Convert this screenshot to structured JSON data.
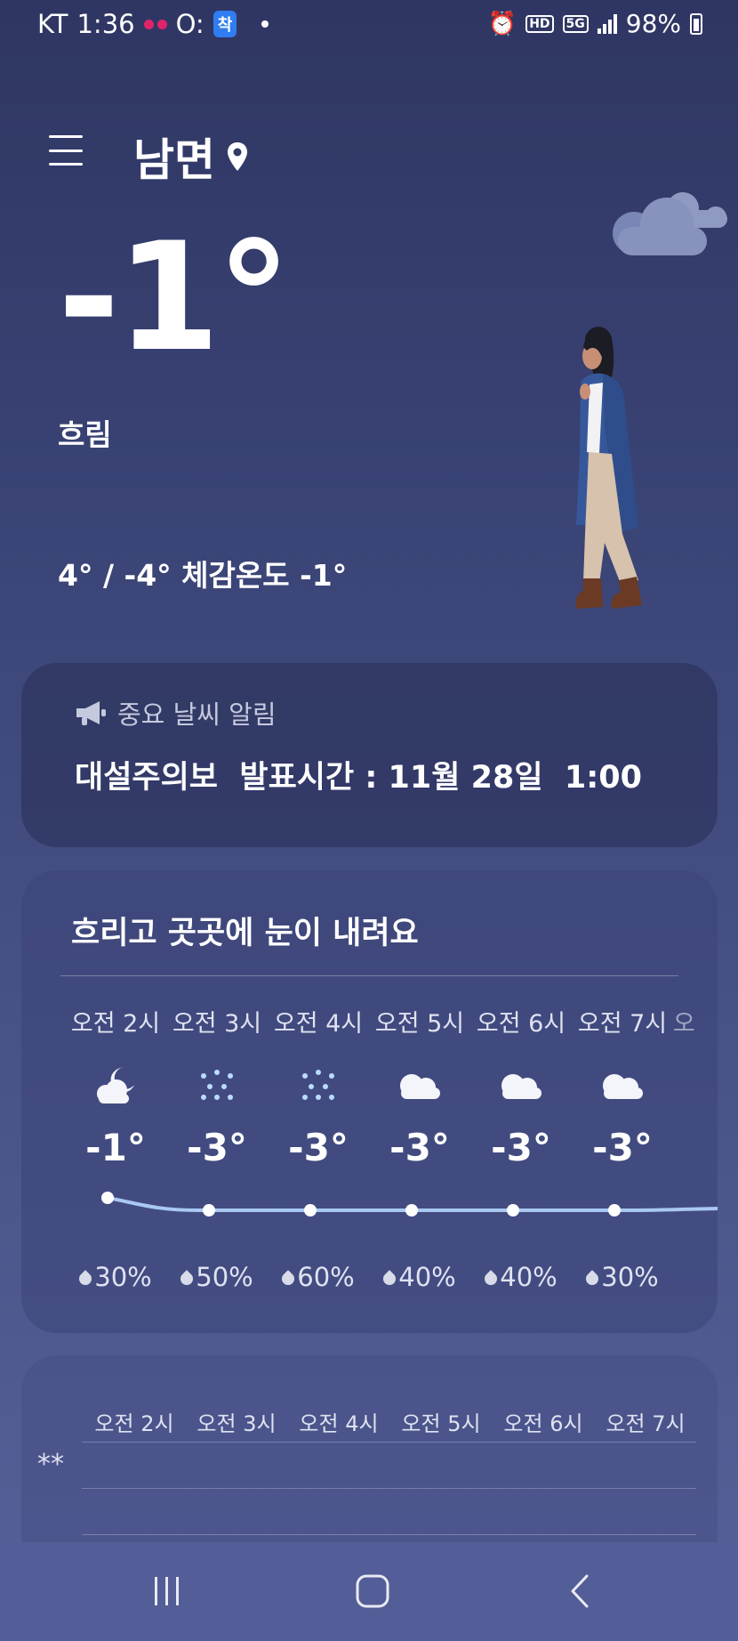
{
  "status_bar": {
    "carrier": "KT",
    "time": "1:36",
    "badge_o": "O:",
    "badge_talk": "착",
    "hd_label": "HD",
    "network": "5G",
    "battery": "98%"
  },
  "header": {
    "location": "남면",
    "menu_icon": "hamburger-menu-icon",
    "location_icon": "location-pin-icon"
  },
  "current": {
    "temp": "-1°",
    "condition": "흐림",
    "hilo_feels": "4° / -4° 체감온도 -1°"
  },
  "alert": {
    "heading": "중요 날씨 알림",
    "text": "대설주의보  발표시간 : 11월 28일  1:00",
    "icon": "megaphone-icon"
  },
  "forecast": {
    "summary": "흐리고 곳곳에 눈이 내려요",
    "hours": [
      {
        "time": "오전 2시",
        "icon": "moon-cloud-icon",
        "temp": "-1°",
        "precip": "30%"
      },
      {
        "time": "오전 3시",
        "icon": "snow-icon",
        "temp": "-3°",
        "precip": "50%"
      },
      {
        "time": "오전 4시",
        "icon": "snow-icon",
        "temp": "-3°",
        "precip": "60%"
      },
      {
        "time": "오전 5시",
        "icon": "cloud-icon",
        "temp": "-3°",
        "precip": "40%"
      },
      {
        "time": "오전 6시",
        "icon": "cloud-icon",
        "temp": "-3°",
        "precip": "40%"
      },
      {
        "time": "오전 7시",
        "icon": "cloud-icon",
        "temp": "-3°",
        "precip": "30%"
      }
    ],
    "next_partial": "오"
  },
  "precip_chart": {
    "hours": [
      "오전 2시",
      "오전 3시",
      "오전 4시",
      "오전 5시",
      "오전 6시",
      "오전 7시"
    ],
    "snow_icon": "**"
  },
  "nav": {
    "recent": "recent-apps-icon",
    "home": "home-icon",
    "back": "back-icon"
  },
  "colors": {
    "background_top": "#2f3663",
    "background_bottom": "#56619a",
    "graph_line": "#a9c8f2"
  }
}
